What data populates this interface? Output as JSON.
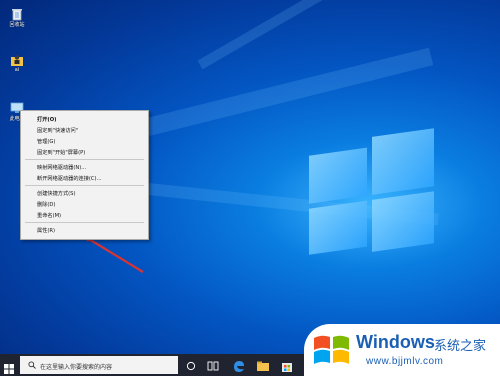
{
  "desktop": {
    "icons": [
      {
        "name": "recycle-bin",
        "label": "回收站"
      },
      {
        "name": "user-folder",
        "label": "ai"
      },
      {
        "name": "this-pc",
        "label": "此电脑"
      }
    ]
  },
  "context_menu": {
    "items": [
      {
        "label": "打开(O)",
        "bold": true
      },
      {
        "label": "固定到\"快速访问\""
      },
      {
        "label": "管理(G)"
      },
      {
        "label": "固定到\"开始\"屏幕(P)"
      },
      {
        "label": "映射网络驱动器(N)..."
      },
      {
        "label": "断开网络驱动器的连接(C)..."
      },
      {
        "label": "创建快捷方式(S)"
      },
      {
        "label": "删除(D)"
      },
      {
        "label": "重命名(M)"
      },
      {
        "label": "属性(R)"
      }
    ]
  },
  "taskbar": {
    "search_placeholder": "在这里输入你要搜索的内容"
  },
  "watermark": {
    "brand": "Windows",
    "cn": "系统之家",
    "url": "www.bjjmlv.com"
  },
  "colors": {
    "desktop_blue": "#0355c2",
    "annotation_arrow": "#d93434",
    "taskbar": "#1f2430",
    "brand_blue": "#1a5fb4"
  }
}
